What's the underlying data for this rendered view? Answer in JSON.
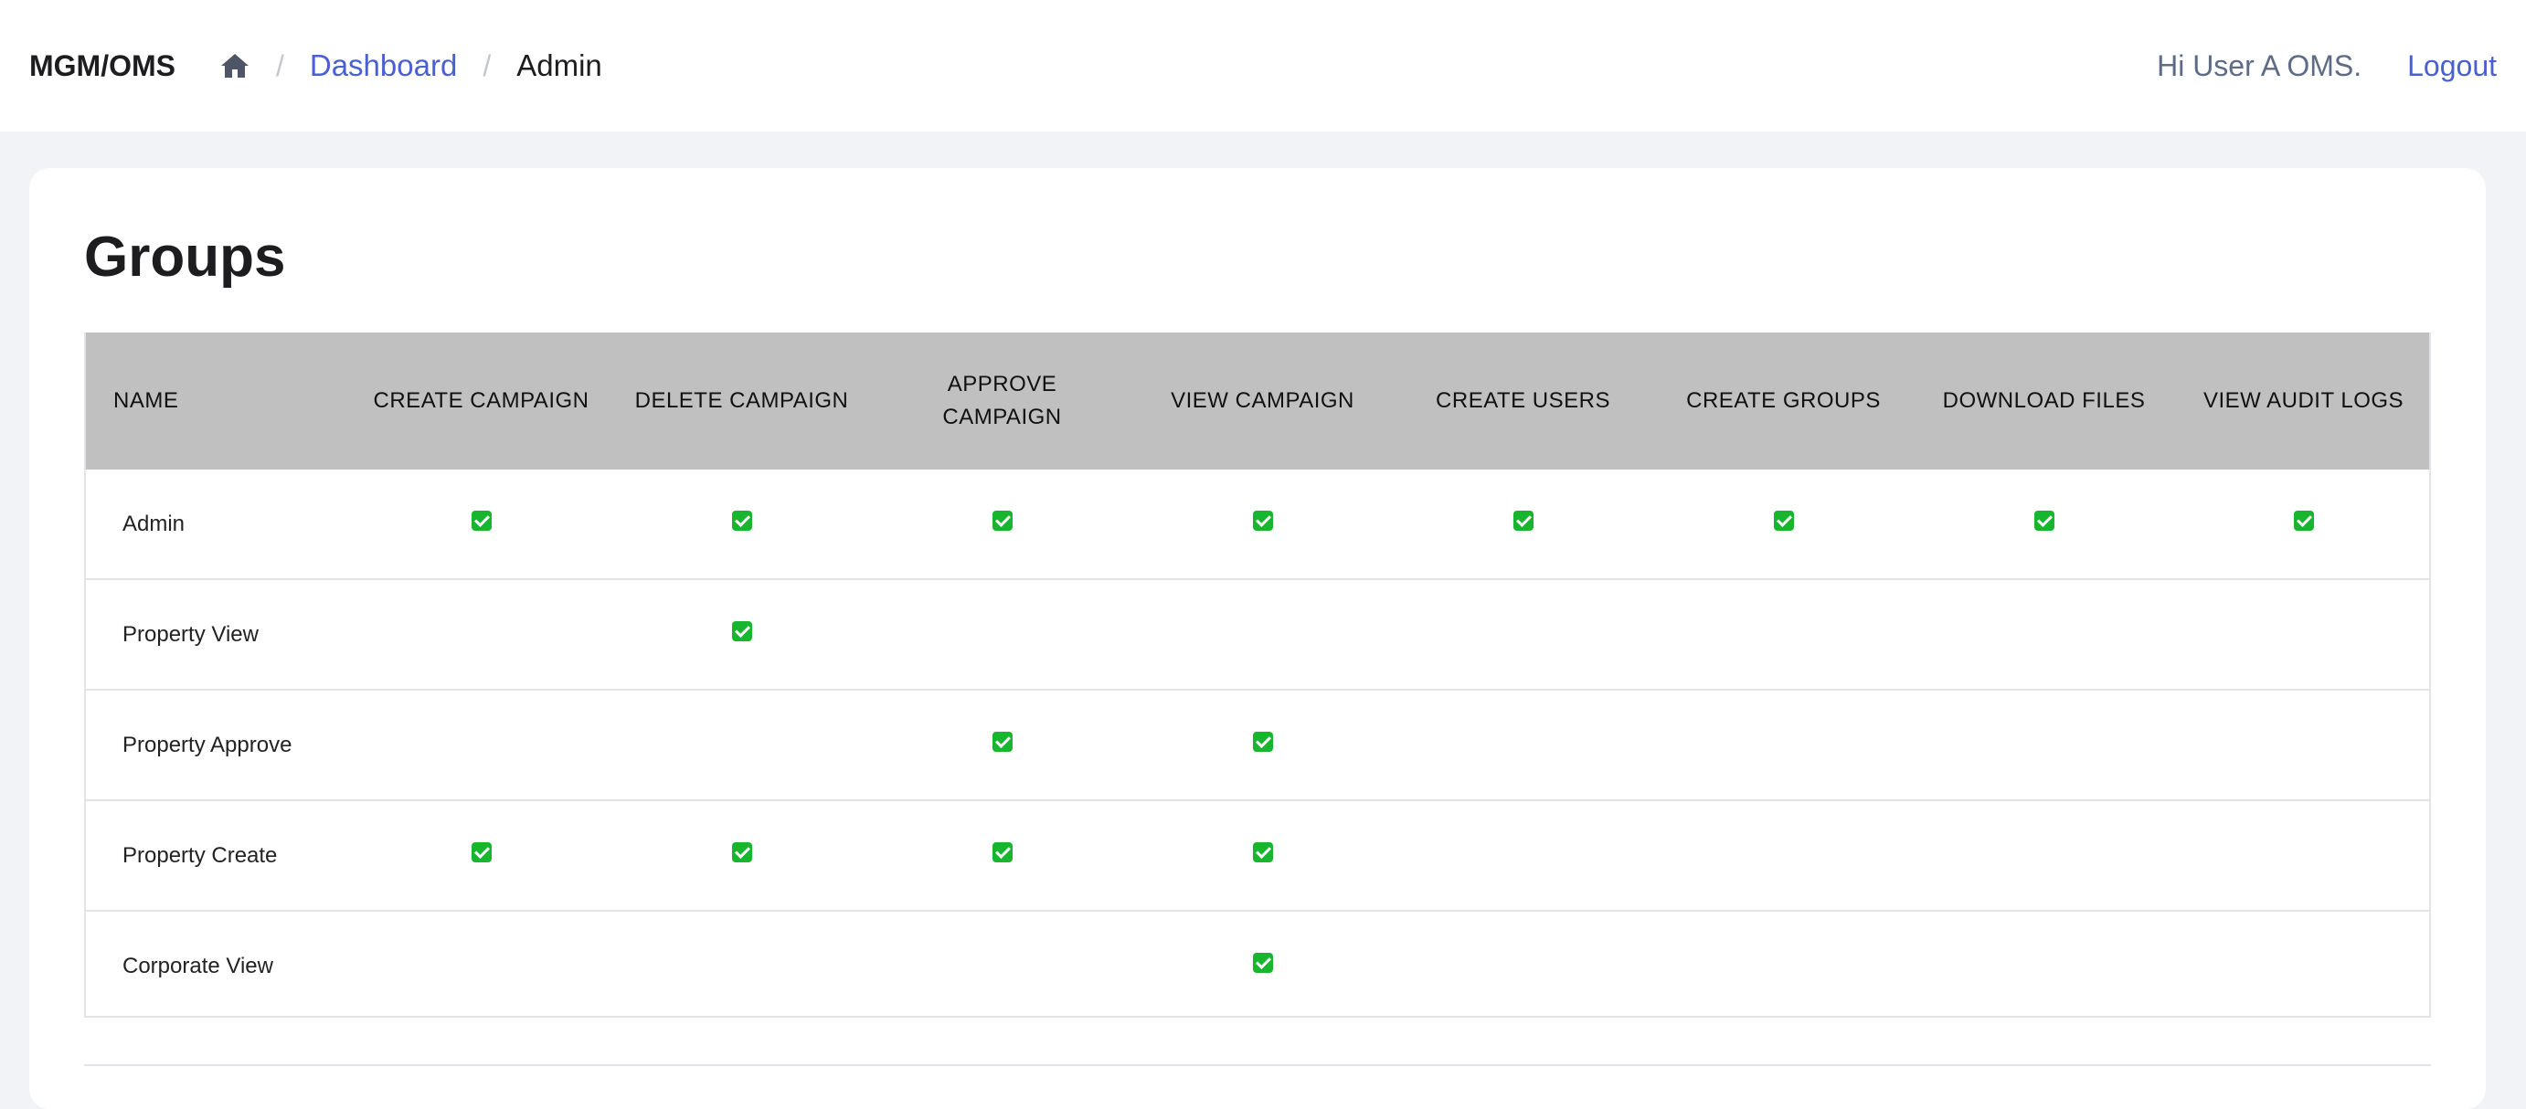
{
  "app": {
    "brand": "MGM/OMS"
  },
  "breadcrumb": {
    "home_icon": "home-icon",
    "separator": "/",
    "items": [
      {
        "label": "Dashboard",
        "link": true
      },
      {
        "label": "Admin",
        "link": false
      }
    ]
  },
  "user": {
    "greeting": "Hi User A OMS.",
    "logout_label": "Logout"
  },
  "page": {
    "title": "Groups"
  },
  "table": {
    "columns": [
      "NAME",
      "CREATE CAMPAIGN",
      "DELETE CAMPAIGN",
      "APPROVE CAMPAIGN",
      "VIEW CAMPAIGN",
      "CREATE USERS",
      "CREATE GROUPS",
      "DOWNLOAD FILES",
      "VIEW AUDIT LOGS"
    ],
    "rows": [
      {
        "name": "Admin",
        "permissions": [
          true,
          true,
          true,
          true,
          true,
          true,
          true,
          true
        ]
      },
      {
        "name": "Property View",
        "permissions": [
          false,
          true,
          false,
          false,
          false,
          false,
          false,
          false
        ]
      },
      {
        "name": "Property Approve",
        "permissions": [
          false,
          false,
          true,
          true,
          false,
          false,
          false,
          false
        ]
      },
      {
        "name": "Property Create",
        "permissions": [
          true,
          true,
          true,
          true,
          false,
          false,
          false,
          false
        ]
      },
      {
        "name": "Corporate View",
        "permissions": [
          false,
          false,
          false,
          true,
          false,
          false,
          false,
          false
        ]
      }
    ],
    "check_icon": "check-icon",
    "check_color": "#18b52e"
  },
  "colors": {
    "accent": "#4a5fd1",
    "header_bg": "#c0c0c0",
    "page_bg": "#f2f3f6"
  }
}
